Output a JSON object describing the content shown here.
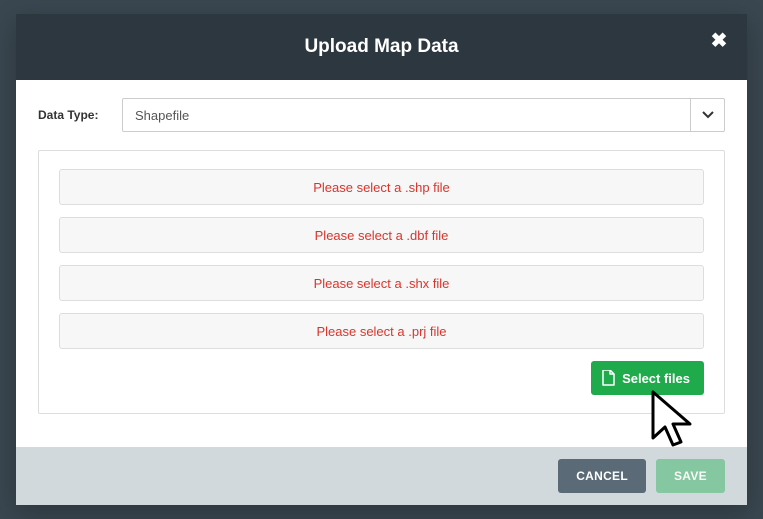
{
  "modal": {
    "title": "Upload Map Data",
    "close_symbol": "✖"
  },
  "form": {
    "data_type_label": "Data Type:",
    "data_type_value": "Shapefile"
  },
  "slots": [
    "Please select a .shp file",
    "Please select a .dbf file",
    "Please select a .shx file",
    "Please select a .prj file"
  ],
  "buttons": {
    "select_files": "Select files",
    "cancel": "CANCEL",
    "save": "SAVE"
  }
}
